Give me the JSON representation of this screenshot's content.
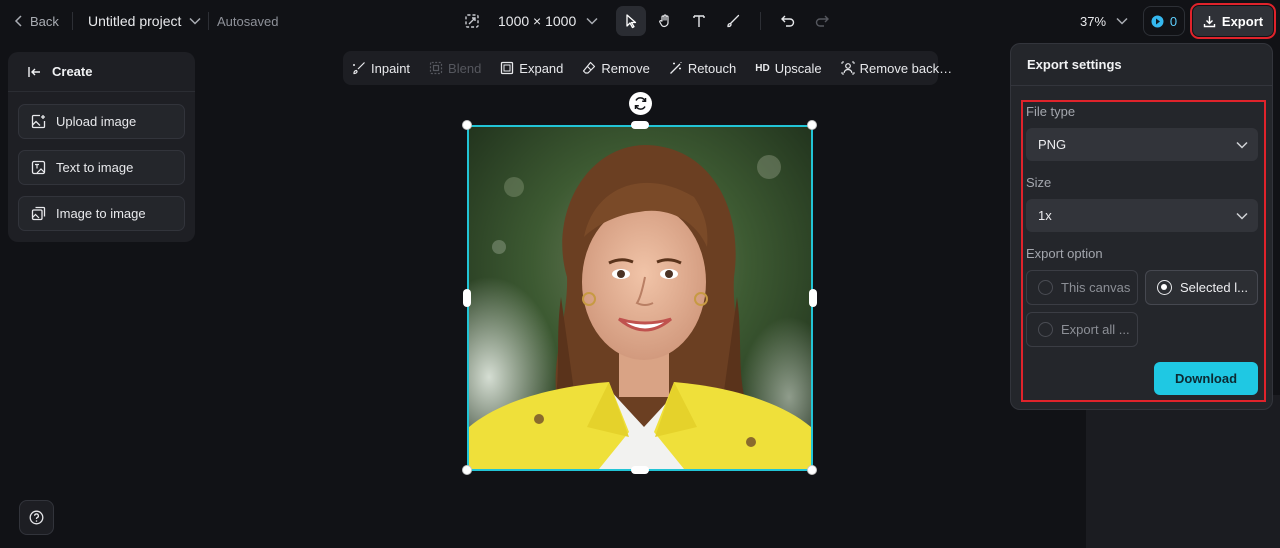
{
  "topbar": {
    "back_label": "Back",
    "project_title": "Untitled project",
    "autosave_status": "Autosaved",
    "canvas_size": "1000 × 1000",
    "zoom_level": "37%",
    "credits_count": "0",
    "export_label": "Export"
  },
  "left_panel": {
    "header_label": "Create",
    "buttons": [
      {
        "label": "Upload image",
        "icon": "upload-image-icon"
      },
      {
        "label": "Text to image",
        "icon": "text-to-image-icon"
      },
      {
        "label": "Image to image",
        "icon": "image-to-image-icon"
      }
    ]
  },
  "edit_toolbar": {
    "items": [
      {
        "label": "Inpaint",
        "enabled": true
      },
      {
        "label": "Blend",
        "enabled": false
      },
      {
        "label": "Expand",
        "enabled": true
      },
      {
        "label": "Remove",
        "enabled": true
      },
      {
        "label": "Retouch",
        "enabled": true
      },
      {
        "label": "Upscale",
        "badge": "HD",
        "enabled": true
      },
      {
        "label": "Remove back…",
        "enabled": true
      }
    ]
  },
  "export_settings": {
    "title": "Export settings",
    "file_type_label": "File type",
    "file_type_value": "PNG",
    "size_label": "Size",
    "size_value": "1x",
    "export_option_label": "Export option",
    "options": [
      {
        "label": "This canvas",
        "selected": false
      },
      {
        "label": "Selected l...",
        "selected": true
      },
      {
        "label": "Export all ...",
        "selected": false
      }
    ],
    "download_label": "Download"
  },
  "colors": {
    "accent": "#1fc8e3",
    "highlight": "#e0232b",
    "selection": "#22c4d6"
  }
}
